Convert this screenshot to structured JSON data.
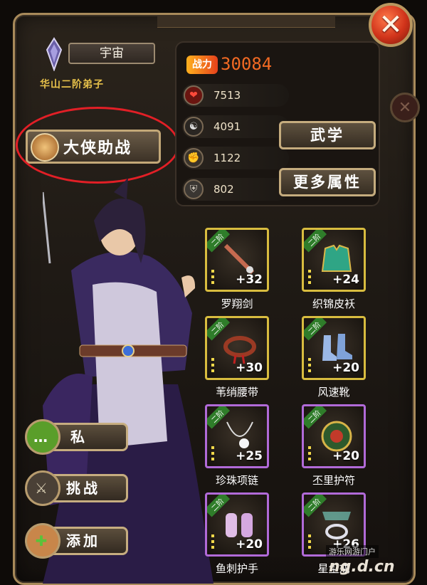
{
  "header": {
    "close_icon": "close-icon"
  },
  "player": {
    "name": "宇宙",
    "title": "华山二阶弟子"
  },
  "helper_button": {
    "label": "大侠助战"
  },
  "stats": {
    "power_label": "战力",
    "power": "30084",
    "hp": "7513",
    "internal": "4091",
    "attack": "1122",
    "defense": "802"
  },
  "buttons": {
    "martial": "武学",
    "more_attrs": "更多属性",
    "private": "私",
    "challenge": "挑战",
    "add": "添加"
  },
  "equipment": [
    {
      "tier": "二阶",
      "plus": "+32",
      "name": "罗翔剑",
      "border": "gold"
    },
    {
      "tier": "二阶",
      "plus": "+24",
      "name": "织锦皮袄",
      "border": "gold"
    },
    {
      "tier": "二阶",
      "plus": "+30",
      "name": "苇绡腰带",
      "border": "gold"
    },
    {
      "tier": "二阶",
      "plus": "+20",
      "name": "风速靴",
      "border": "gold"
    },
    {
      "tier": "二阶",
      "plus": "+25",
      "name": "珍珠项链",
      "border": "purple"
    },
    {
      "tier": "二阶",
      "plus": "+20",
      "name": "丕里护符",
      "border": "purple"
    },
    {
      "tier": "二阶",
      "plus": "+20",
      "name": "鱼刺护手",
      "border": "purple"
    },
    {
      "tier": "二阶",
      "plus": "+26",
      "name": "星尘戒",
      "border": "purple"
    }
  ],
  "watermark": {
    "line1": "游乐网游门户",
    "line2": "ng.d.cn"
  }
}
